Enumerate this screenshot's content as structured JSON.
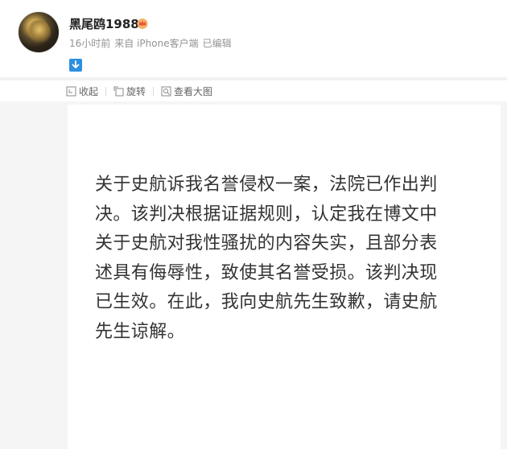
{
  "post": {
    "username": "黑尾鸥1988",
    "meta": {
      "time": "16小时前",
      "source": "来自 iPhone客户端",
      "edited": "已编辑"
    }
  },
  "actions": [
    {
      "label": "收起",
      "icon": "collapse-icon"
    },
    {
      "label": "旋转",
      "icon": "rotate-icon"
    },
    {
      "label": "查看大图",
      "icon": "view-large-icon"
    }
  ],
  "notice": {
    "lines": [
      "关于史航诉我名誉侵权一案，法院已作出判",
      "决。该判决根据证据规则，认定我在博文中",
      "关于史航对我性骚扰的内容失实，且部分表",
      "述具有侮辱性，致使其名誉受损。该判决现",
      "已生效。在此，我向史航先生致歉，请史航",
      "先生谅解。"
    ]
  },
  "colors": {
    "accent": "#2f8fe0",
    "badge": "#f0a04b",
    "text": "#333333"
  }
}
